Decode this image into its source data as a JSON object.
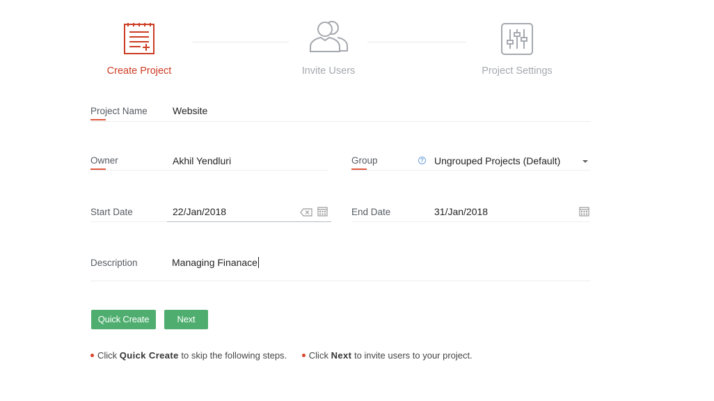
{
  "stepper": {
    "steps": [
      {
        "label": "Create Project",
        "state": "active"
      },
      {
        "label": "Invite Users",
        "state": "inactive"
      },
      {
        "label": "Project Settings",
        "state": "inactive"
      }
    ]
  },
  "form": {
    "project_name": {
      "label": "Project Name",
      "value": "Website"
    },
    "owner": {
      "label": "Owner",
      "value": "Akhil Yendluri"
    },
    "group": {
      "label": "Group",
      "value": "Ungrouped Projects (Default)",
      "help_icon": "help-icon"
    },
    "start_date": {
      "label": "Start Date",
      "value": "22/Jan/2018"
    },
    "end_date": {
      "label": "End Date",
      "value": "31/Jan/2018"
    },
    "description": {
      "label": "Description",
      "value": "Managing Finanace"
    }
  },
  "buttons": {
    "quick_create": "Quick Create",
    "next": "Next"
  },
  "hints": {
    "quick_create": {
      "prefix": "Click ",
      "keyword": "Quick Create",
      "suffix": " to skip the following steps."
    },
    "next": {
      "prefix": "Click ",
      "keyword": "Next",
      "suffix": " to invite users to your project."
    }
  },
  "colors": {
    "accent": "#cc3b22",
    "button_green": "#4fae6f",
    "inactive": "#a4a8ae",
    "help_blue": "#6a9fd9"
  }
}
